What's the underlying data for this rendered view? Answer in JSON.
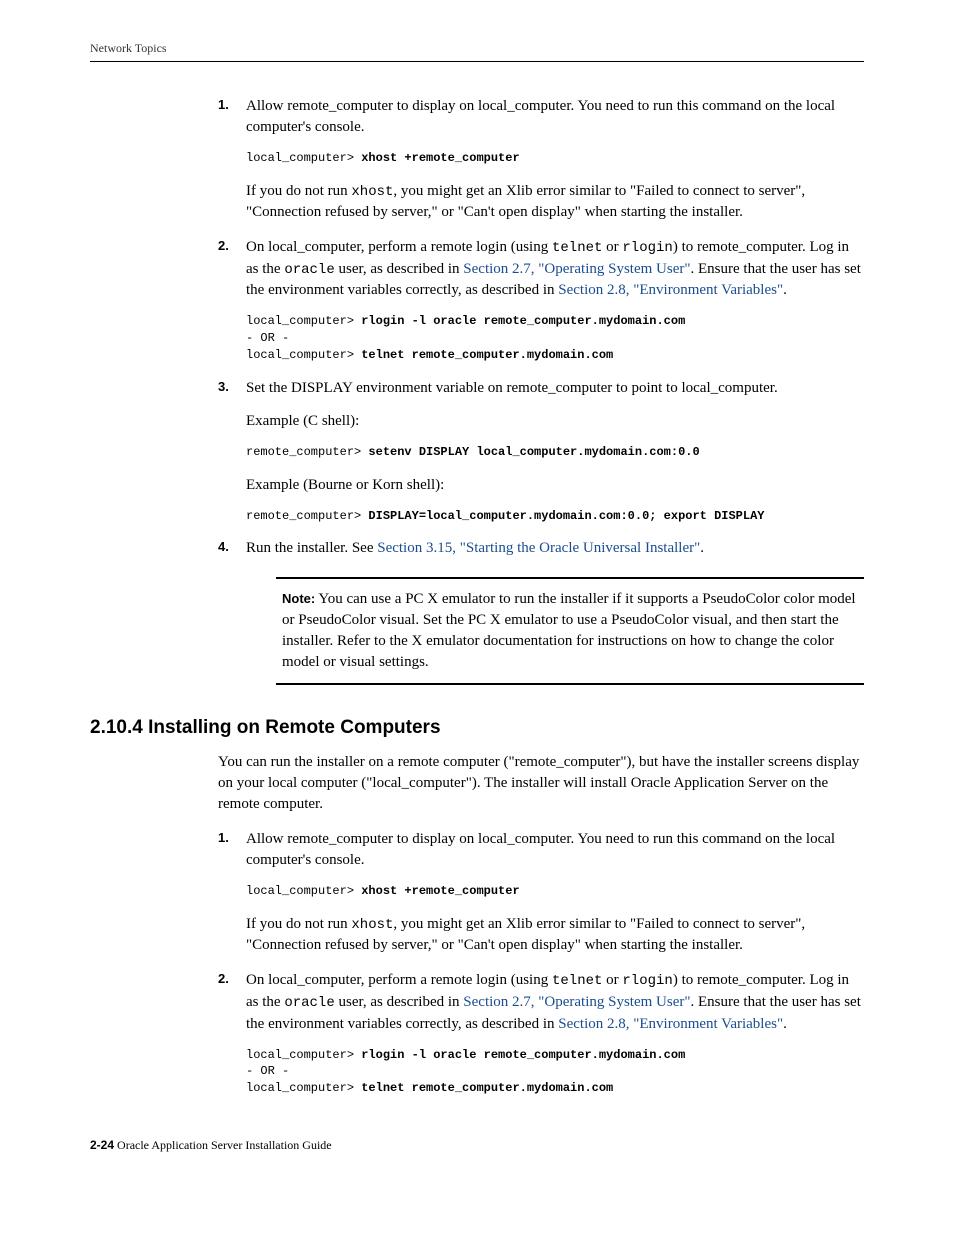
{
  "header": {
    "running_head": "Network Topics"
  },
  "topList": {
    "item1": {
      "num": "1.",
      "para1": "Allow remote_computer to display on local_computer. You need to run this command on the local computer's console.",
      "code_prompt": "local_computer> ",
      "code_cmd": "xhost +remote_computer",
      "para2a": "If you do not run ",
      "para2_code": "xhost",
      "para2b": ", you might get an Xlib error similar to \"Failed to connect to server\", \"Connection refused by server,\" or \"Can't open display\" when starting the installer."
    },
    "item2": {
      "num": "2.",
      "p_a": "On local_computer, perform a remote login (using ",
      "p_code1": "telnet",
      "p_b": " or ",
      "p_code2": "rlogin",
      "p_c": ") to remote_computer. Log in as the ",
      "p_code3": "oracle",
      "p_d": " user, as described in ",
      "link1": "Section 2.7, \"Operating System User\"",
      "p_e": ". Ensure that the user has set the environment variables correctly, as described in ",
      "link2": "Section 2.8, \"Environment Variables\"",
      "p_f": ".",
      "code_line1_prompt": "local_computer> ",
      "code_line1_cmd": "rlogin -l oracle remote_computer.mydomain.com",
      "code_line2": "- OR -",
      "code_line3_prompt": "local_computer> ",
      "code_line3_cmd": "telnet remote_computer.mydomain.com"
    },
    "item3": {
      "num": "3.",
      "para1": "Set the DISPLAY environment variable on remote_computer to point to local_computer.",
      "ex1_label": "Example (C shell):",
      "ex1_prompt": "remote_computer> ",
      "ex1_cmd": "setenv DISPLAY local_computer.mydomain.com:0.0",
      "ex2_label": "Example (Bourne or Korn shell):",
      "ex2_prompt": "remote_computer> ",
      "ex2_cmd": "DISPLAY=local_computer.mydomain.com:0.0; export DISPLAY"
    },
    "item4": {
      "num": "4.",
      "p_a": "Run the installer. See ",
      "link": "Section 3.15, \"Starting the Oracle Universal Installer\"",
      "p_b": "."
    }
  },
  "note": {
    "label": "Note:",
    "text": "   You can use a PC X emulator to run the installer if it supports a PseudoColor color model or PseudoColor visual. Set the PC X emulator to use a PseudoColor visual, and then start the installer. Refer to the X emulator documentation for instructions on how to change the color model or visual settings."
  },
  "section": {
    "heading": "2.10.4  Installing on Remote Computers",
    "intro": "You can run the installer on a remote computer (\"remote_computer\"), but have the installer screens display on your local computer (\"local_computer\"). The installer will install Oracle Application Server on the remote computer."
  },
  "bottomList": {
    "item1": {
      "num": "1.",
      "para1": "Allow remote_computer to display on local_computer. You need to run this command on the local computer's console.",
      "code_prompt": "local_computer> ",
      "code_cmd": "xhost +remote_computer",
      "para2a": "If you do not run ",
      "para2_code": "xhost",
      "para2b": ", you might get an Xlib error similar to \"Failed to connect to server\", \"Connection refused by server,\" or \"Can't open display\" when starting the installer."
    },
    "item2": {
      "num": "2.",
      "p_a": "On local_computer, perform a remote login (using ",
      "p_code1": "telnet",
      "p_b": " or ",
      "p_code2": "rlogin",
      "p_c": ") to remote_computer. Log in as the ",
      "p_code3": "oracle",
      "p_d": " user, as described in ",
      "link1": "Section 2.7, \"Operating System User\"",
      "p_e": ". Ensure that the user has set the environment variables correctly, as described in ",
      "link2": "Section 2.8, \"Environment Variables\"",
      "p_f": ".",
      "code_line1_prompt": "local_computer> ",
      "code_line1_cmd": "rlogin -l oracle remote_computer.mydomain.com",
      "code_line2": "- OR -",
      "code_line3_prompt": "local_computer> ",
      "code_line3_cmd": "telnet remote_computer.mydomain.com"
    }
  },
  "footer": {
    "pagenum": "2-24",
    "title": "   Oracle Application Server Installation Guide"
  }
}
